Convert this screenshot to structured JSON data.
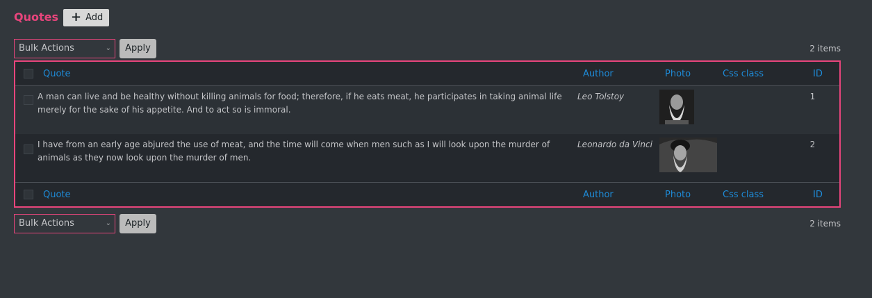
{
  "header": {
    "title": "Quotes",
    "add_label": "Add"
  },
  "tablenav_top": {
    "bulk_actions": "Bulk Actions",
    "apply_label": "Apply",
    "items_count": "2 items"
  },
  "tablenav_bottom": {
    "bulk_actions": "Bulk Actions",
    "apply_label": "Apply",
    "items_count": "2 items"
  },
  "table": {
    "columns": [
      "Quote",
      "Author",
      "Photo",
      "Css class",
      "ID"
    ],
    "rows": [
      {
        "quote": "A man can live and be healthy without killing animals for food; therefore, if he eats meat, he participates in taking animal life merely for the sake of his appetite. And to act so is immoral.",
        "author": "Leo Tolstoy",
        "photo": "portrait-icon",
        "css_class": "",
        "id": "1"
      },
      {
        "quote": "I have from an early age abjured the use of meat, and the time will come when men such as I will look upon the murder of animals as they now look upon the murder of men.",
        "author": "Leonardo da Vinci",
        "photo": "portrait-icon",
        "css_class": "",
        "id": "2"
      }
    ]
  },
  "colors": {
    "accent": "#e8457c",
    "link": "#1e8ad6",
    "background": "#32373c"
  }
}
